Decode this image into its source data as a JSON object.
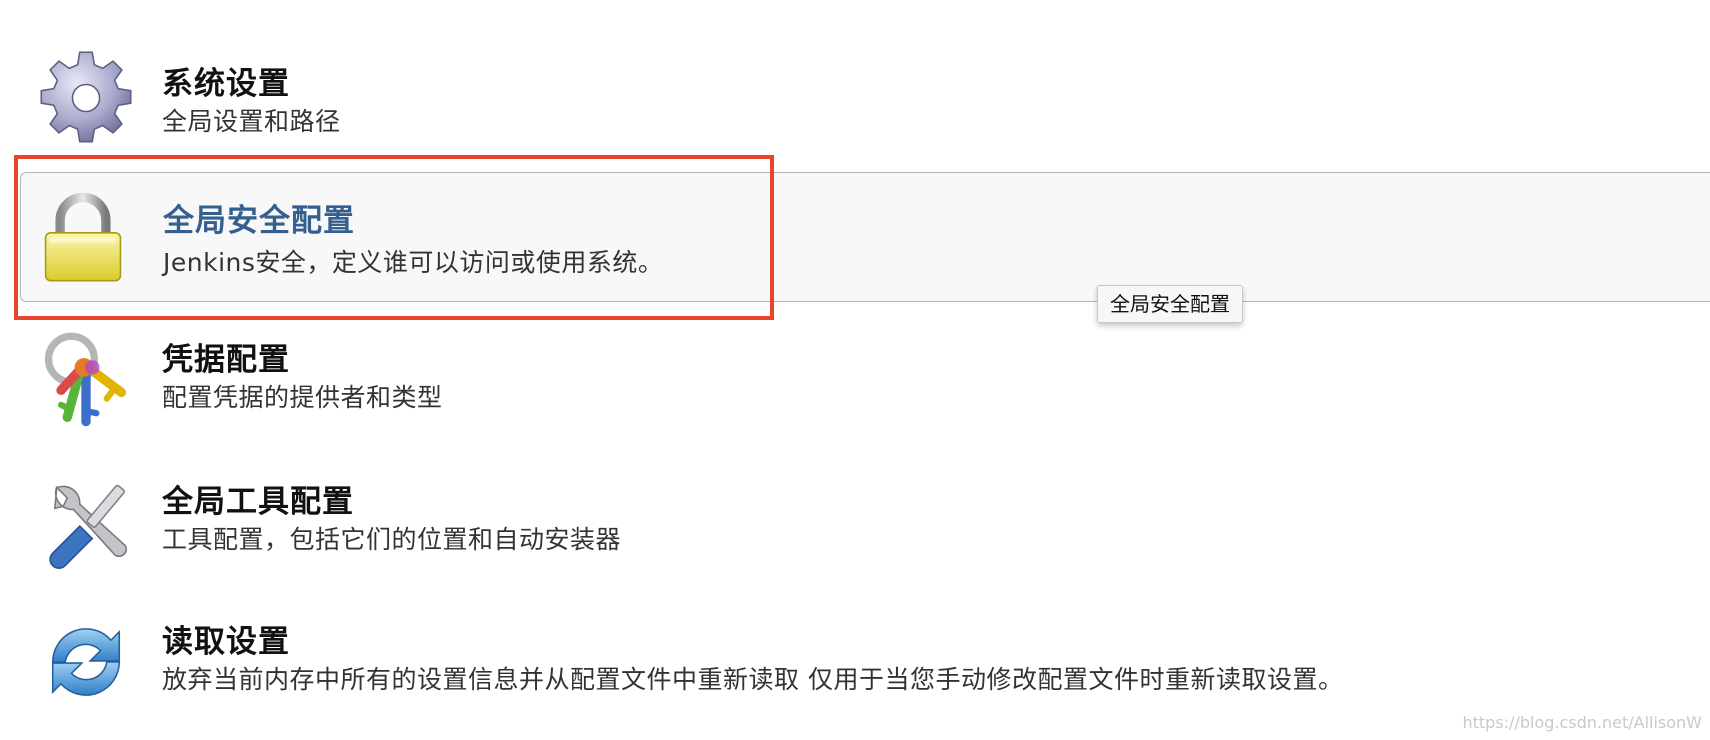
{
  "items": [
    {
      "title": "系统设置",
      "desc": "全局设置和路径",
      "icon": "gear-icon"
    },
    {
      "title": "全局安全配置",
      "desc": "Jenkins安全，定义谁可以访问或使用系统。",
      "icon": "lock-icon",
      "state": "hovered"
    },
    {
      "title": "凭据配置",
      "desc": "配置凭据的提供者和类型",
      "icon": "keys-icon"
    },
    {
      "title": "全局工具配置",
      "desc": "工具配置，包括它们的位置和自动安装器",
      "icon": "tools-icon"
    },
    {
      "title": "读取设置",
      "desc": "放弃当前内存中所有的设置信息并从配置文件中重新读取 仅用于当您手动修改配置文件时重新读取设置。",
      "icon": "reload-icon"
    }
  ],
  "tooltip": "全局安全配置",
  "watermark": "https://blog.csdn.net/AllisonW",
  "colors": {
    "highlight": "#e8452c",
    "hover_title": "#34608f"
  }
}
